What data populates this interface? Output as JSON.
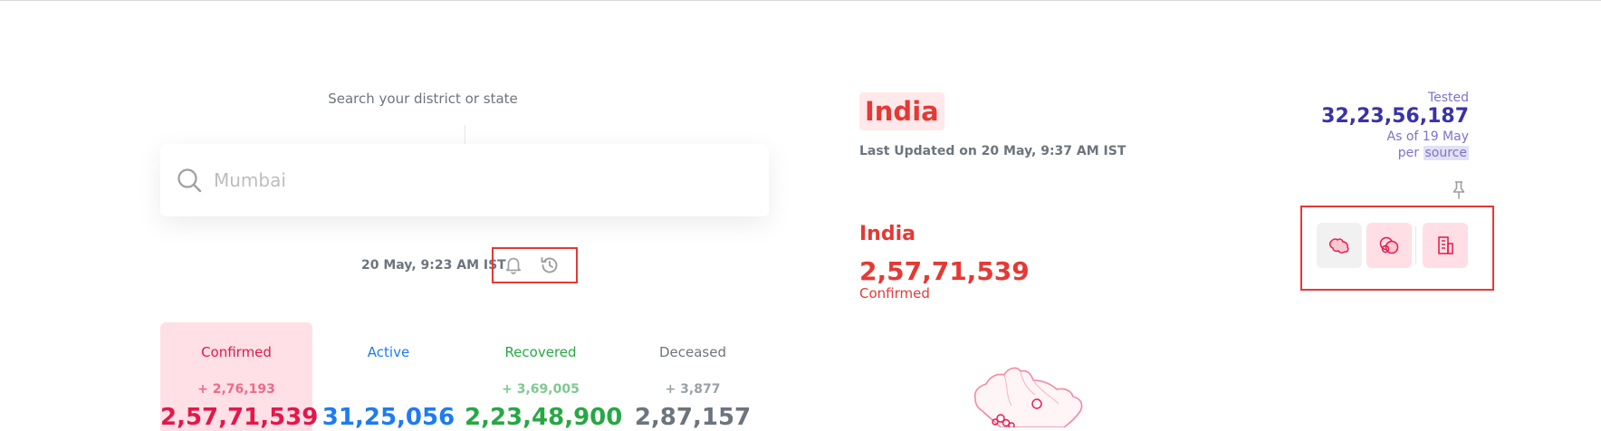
{
  "search": {
    "hint": "Search your district or state",
    "placeholder": "Mumbai"
  },
  "last_updated": {
    "text": "20 May, 9:23 AM IST"
  },
  "stats": [
    {
      "label": "Confirmed",
      "delta": "+ 2,76,193",
      "value": "2,57,71,539",
      "color": "#e4174b",
      "delta_color": "#f06a88"
    },
    {
      "label": "Active",
      "delta": "",
      "value": "31,25,056",
      "color": "#1e7bf2",
      "delta_color": "#1e7bf2"
    },
    {
      "label": "Recovered",
      "delta": "+ 3,69,005",
      "value": "2,23,48,900",
      "color": "#28a745",
      "delta_color": "#7ec98f"
    },
    {
      "label": "Deceased",
      "delta": "+ 3,877",
      "value": "2,87,157",
      "color": "#6c757d",
      "delta_color": "#9aa1a7"
    }
  ],
  "header": {
    "title": "India",
    "updated": "Last Updated on 20 May, 9:37 AM IST"
  },
  "tested": {
    "label": "Tested",
    "value": "32,23,56,187",
    "as_of": "As of 19 May",
    "per": "per",
    "source": "source"
  },
  "map_panel": {
    "place": "India",
    "value": "2,57,71,539",
    "stat": "Confirmed"
  },
  "colors": {
    "accent": "#e53935",
    "tested": "#3a32a8"
  },
  "icons": [
    "search-icon",
    "bell-icon",
    "history-icon",
    "pin-icon",
    "states-map-icon",
    "bubbles-icon",
    "districts-icon"
  ]
}
